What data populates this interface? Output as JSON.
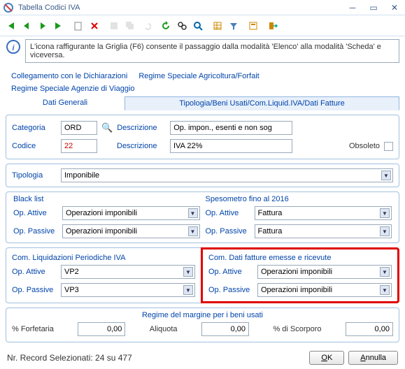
{
  "window": {
    "title": "Tabella Codici IVA"
  },
  "info": "L'icona  raffigurante la Griglia (F6) consente  il passaggio dalla modalità  'Elenco'  alla modalità  'Scheda'  e viceversa.",
  "tabs": {
    "row1": [
      "Collegamento con le Dichiarazioni",
      "Regime Speciale Agricoltura/Forfait",
      "Regime Speciale Agenzie di Viaggio"
    ],
    "row2_left": "Dati Generali",
    "row2_active": "Tipologia/Beni Usati/Com.Liquid.IVA/Dati Fatture"
  },
  "head": {
    "categoria_label": "Categoria",
    "categoria_val": "ORD",
    "descr_label": "Descrizione",
    "descr1_val": "Op. impon., esenti e non sog",
    "codice_label": "Codice",
    "codice_val": "22",
    "descr2_val": "IVA 22%",
    "obsoleto_label": "Obsoleto"
  },
  "tipologia": {
    "label": "Tipologia",
    "val": "Imponibile"
  },
  "blacklist": {
    "title": "Black list",
    "attive_label": "Op. Attive",
    "attive_val": "Operazioni imponibili",
    "passive_label": "Op. Passive",
    "passive_val": "Operazioni imponibili"
  },
  "speso": {
    "title": "Spesometro fino al 2016",
    "attive_label": "Op. Attive",
    "attive_val": "Fattura",
    "passive_label": "Op. Passive",
    "passive_val": "Fattura"
  },
  "liquid": {
    "title": "Com. Liquidazioni Periodiche IVA",
    "attive_label": "Op. Attive",
    "attive_val": "VP2",
    "passive_label": "Op. Passive",
    "passive_val": "VP3"
  },
  "datifatt": {
    "title": "Com. Dati fatture emesse e ricevute",
    "attive_label": "Op. Attive",
    "attive_val": "Operazioni imponibili",
    "passive_label": "Op. Passive",
    "passive_val": "Operazioni imponibili"
  },
  "margine": {
    "title": "Regime del margine per i beni usati",
    "forf_label": "% Forfetaria",
    "forf_val": "0,00",
    "aliq_label": "Aliquota",
    "aliq_val": "0,00",
    "scorp_label": "% di Scorporo",
    "scorp_val": "0,00"
  },
  "footer": {
    "status": "Nr. Record Selezionati: 24 su 477",
    "ok": "OK",
    "annulla": "Annulla"
  }
}
